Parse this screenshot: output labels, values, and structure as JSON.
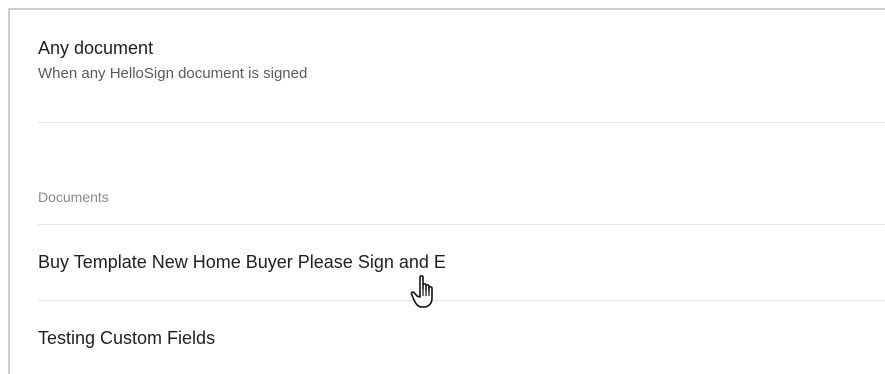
{
  "trigger_option": {
    "title": "Any document",
    "description": "When any HelloSign document is signed"
  },
  "documents_section": {
    "label": "Documents",
    "items": [
      {
        "label": "Buy Template New Home Buyer Please Sign and E"
      },
      {
        "label": "Testing Custom Fields"
      }
    ]
  },
  "cursor": {
    "icon": "hand-pointer-icon"
  }
}
